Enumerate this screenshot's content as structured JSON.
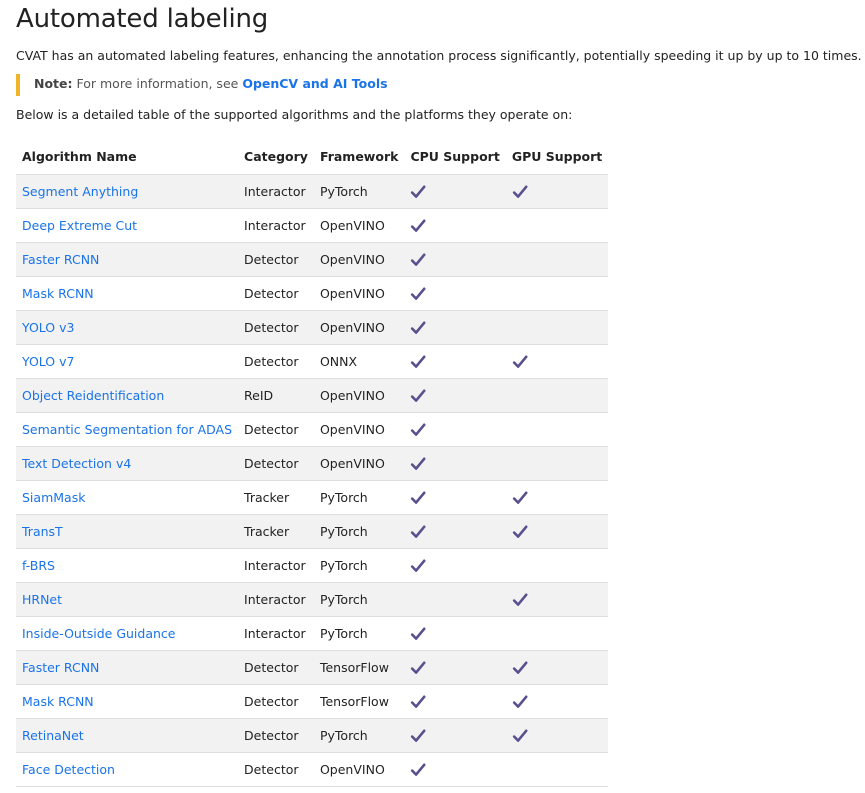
{
  "title": "Automated labeling",
  "intro": "CVAT has an automated labeling features, enhancing the annotation process significantly, potentially speeding it up by up to 10 times.",
  "note": {
    "label": "Note:",
    "text": " For more information, see ",
    "link": "OpenCV and AI Tools",
    "accent_color": "#f0b429"
  },
  "below_text": "Below is a detailed table of the supported algorithms and the platforms they operate on:",
  "table": {
    "headers": [
      "Algorithm Name",
      "Category",
      "Framework",
      "CPU Support",
      "GPU Support"
    ],
    "check_icon": "check-icon",
    "check_color": "#5a4f8e",
    "rows": [
      {
        "name": "Segment Anything",
        "category": "Interactor",
        "framework": "PyTorch",
        "cpu": true,
        "gpu": true
      },
      {
        "name": "Deep Extreme Cut",
        "category": "Interactor",
        "framework": "OpenVINO",
        "cpu": true,
        "gpu": false
      },
      {
        "name": "Faster RCNN",
        "category": "Detector",
        "framework": "OpenVINO",
        "cpu": true,
        "gpu": false
      },
      {
        "name": "Mask RCNN",
        "category": "Detector",
        "framework": "OpenVINO",
        "cpu": true,
        "gpu": false
      },
      {
        "name": "YOLO v3",
        "category": "Detector",
        "framework": "OpenVINO",
        "cpu": true,
        "gpu": false
      },
      {
        "name": "YOLO v7",
        "category": "Detector",
        "framework": "ONNX",
        "cpu": true,
        "gpu": true
      },
      {
        "name": "Object Reidentification",
        "category": "ReID",
        "framework": "OpenVINO",
        "cpu": true,
        "gpu": false
      },
      {
        "name": "Semantic Segmentation for ADAS",
        "category": "Detector",
        "framework": "OpenVINO",
        "cpu": true,
        "gpu": false
      },
      {
        "name": "Text Detection v4",
        "category": "Detector",
        "framework": "OpenVINO",
        "cpu": true,
        "gpu": false
      },
      {
        "name": "SiamMask",
        "category": "Tracker",
        "framework": "PyTorch",
        "cpu": true,
        "gpu": true
      },
      {
        "name": "TransT",
        "category": "Tracker",
        "framework": "PyTorch",
        "cpu": true,
        "gpu": true
      },
      {
        "name": "f-BRS",
        "category": "Interactor",
        "framework": "PyTorch",
        "cpu": true,
        "gpu": false
      },
      {
        "name": "HRNet",
        "category": "Interactor",
        "framework": "PyTorch",
        "cpu": false,
        "gpu": true
      },
      {
        "name": "Inside-Outside Guidance",
        "category": "Interactor",
        "framework": "PyTorch",
        "cpu": true,
        "gpu": false
      },
      {
        "name": "Faster RCNN",
        "category": "Detector",
        "framework": "TensorFlow",
        "cpu": true,
        "gpu": true
      },
      {
        "name": "Mask RCNN",
        "category": "Detector",
        "framework": "TensorFlow",
        "cpu": true,
        "gpu": true
      },
      {
        "name": "RetinaNet",
        "category": "Detector",
        "framework": "PyTorch",
        "cpu": true,
        "gpu": true
      },
      {
        "name": "Face Detection",
        "category": "Detector",
        "framework": "OpenVINO",
        "cpu": true,
        "gpu": false
      }
    ]
  }
}
